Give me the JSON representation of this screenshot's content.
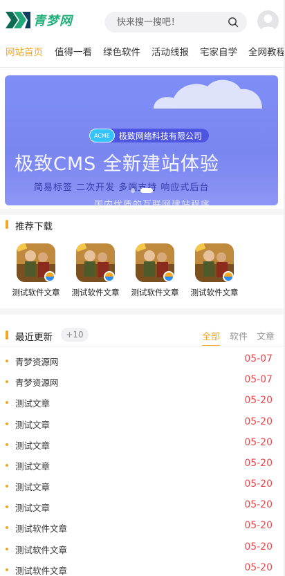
{
  "header": {
    "logo_text": "青梦网",
    "search_placeholder": "快来搜一搜吧！"
  },
  "nav": {
    "items": [
      "网站首页",
      "值得一看",
      "绿色软件",
      "活动线报",
      "宅家自学",
      "全网教程"
    ],
    "active_index": 0
  },
  "banner": {
    "badge_tag": "ACME",
    "badge_text": "极致网络科技有限公司",
    "title": "极致CMS 全新建站体验",
    "subtitle": "简易标签 二次开发 多端支持 响应式后台",
    "subtitle2": "国内优质的互联网建站程序"
  },
  "recommend": {
    "title": "推荐下载",
    "apps": [
      {
        "label": "测试软件文章",
        "icon": "game-app-icon"
      },
      {
        "label": "测试软件文章",
        "icon": "game-app-icon"
      },
      {
        "label": "测试软件文章",
        "icon": "game-app-icon"
      },
      {
        "label": "测试软件文章",
        "icon": "game-app-icon"
      }
    ]
  },
  "latest": {
    "title": "最近更新",
    "count": "+10",
    "filters": [
      "全部",
      "软件",
      "文章"
    ],
    "active_filter": 0,
    "rows": [
      {
        "title": "青梦资源网",
        "date": "05-07"
      },
      {
        "title": "青梦资源网",
        "date": "05-07"
      },
      {
        "title": "测试文章",
        "date": "05-20"
      },
      {
        "title": "测试文章",
        "date": "05-20"
      },
      {
        "title": "测试文章",
        "date": "05-20"
      },
      {
        "title": "测试文章",
        "date": "05-20"
      },
      {
        "title": "测试文章",
        "date": "05-20"
      },
      {
        "title": "测试文章",
        "date": "05-20"
      },
      {
        "title": "测试软件文章",
        "date": "05-20"
      },
      {
        "title": "测试软件文章",
        "date": "05-20"
      },
      {
        "title": "测试软件文章",
        "date": "05-20"
      }
    ]
  },
  "colors": {
    "accent": "#f5a623",
    "date": "#e5484d",
    "logo": "#23b07d",
    "banner": "#7f8ef7"
  }
}
